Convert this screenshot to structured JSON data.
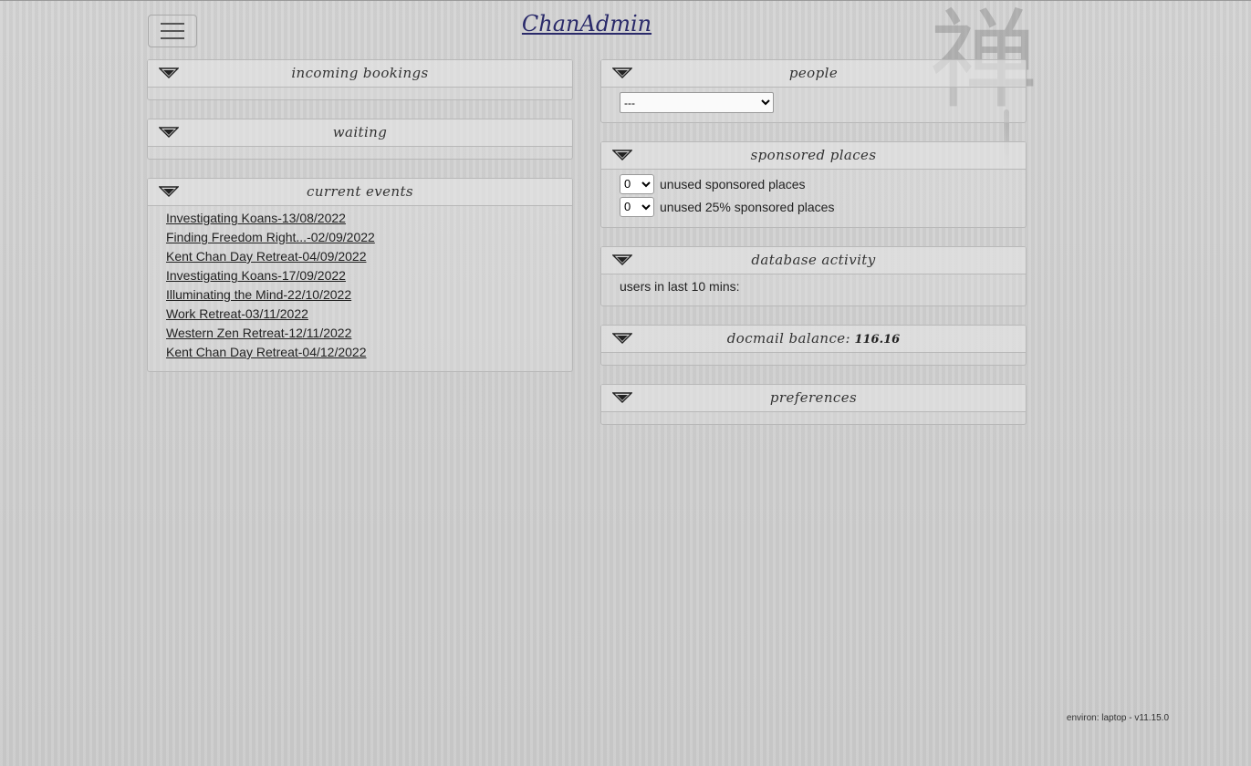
{
  "app": {
    "brand": "ChanAdmin",
    "kanji": "禅"
  },
  "left": {
    "incoming": {
      "title": "incoming bookings"
    },
    "waiting": {
      "title": "waiting"
    },
    "current": {
      "title": "current events",
      "events": [
        "Investigating Koans-13/08/2022",
        "Finding Freedom Right...-02/09/2022",
        "Kent Chan Day Retreat-04/09/2022",
        "Investigating Koans-17/09/2022",
        "Illuminating the Mind-22/10/2022",
        "Work Retreat-03/11/2022",
        "Western Zen Retreat-12/11/2022",
        "Kent Chan Day Retreat-04/12/2022"
      ]
    }
  },
  "right": {
    "people": {
      "title": "people",
      "selected": "---"
    },
    "sponsored": {
      "title": "sponsored places",
      "unused_value": "0",
      "unused_label": "unused sponsored places",
      "unused25_value": "0",
      "unused25_label": "unused 25% sponsored places"
    },
    "activity": {
      "title": "database activity",
      "users_label": "users in last 10 mins:"
    },
    "docmail": {
      "title": "docmail balance:",
      "value": "116.16"
    },
    "preferences": {
      "title": "preferences"
    }
  },
  "footer": {
    "environ": "environ: laptop - v11.15.0"
  },
  "icons": {
    "menu": "hamburger-menu-icon",
    "toggle": "collapse-toggle-icon"
  },
  "colors": {
    "brand": "#2a2a6a",
    "background": "#d2d2d2"
  }
}
